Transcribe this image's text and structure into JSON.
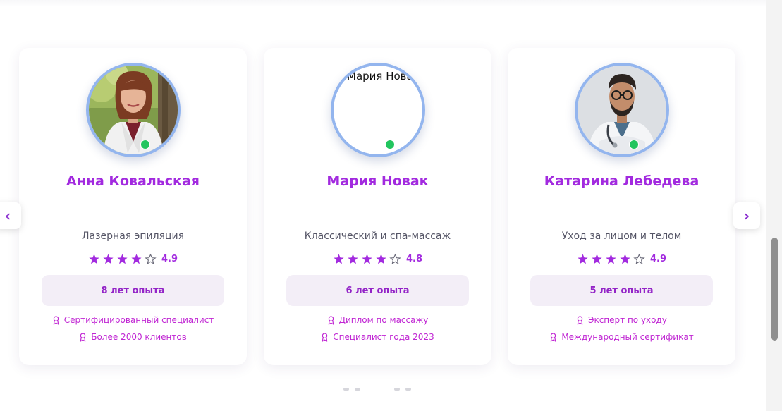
{
  "nav": {
    "prev_icon": "chevron-left-icon",
    "prev_glyph": "‹",
    "next_icon": "chevron-right-icon",
    "next_glyph": "›"
  },
  "colors": {
    "accent": "#a22adf",
    "online": "#22c55e",
    "experience_bg": "#f3eef7",
    "certificate_text": "#c026d3"
  },
  "specialists": [
    {
      "name": "Анна Ковальская",
      "specialty": "Лазерная эпиляция",
      "stars_filled": 4,
      "stars_total": 5,
      "rating": "4.9",
      "experience": "8 лет опыта",
      "certificates": [
        "Сертифицированный специалист",
        "Более 2000 клиентов"
      ],
      "photo_alt": "",
      "online": true
    },
    {
      "name": "Мария Новак",
      "specialty": "Классический и спа-массаж",
      "stars_filled": 4,
      "stars_total": 5,
      "rating": "4.8",
      "experience": "6 лет опыта",
      "certificates": [
        "Диплом по массажу",
        "Специалист года 2023"
      ],
      "photo_alt": "Мария Новак",
      "online": true
    },
    {
      "name": "Катарина Лебедева",
      "specialty": "Уход за лицом и телом",
      "stars_filled": 4,
      "stars_total": 5,
      "rating": "4.9",
      "experience": "5 лет опыта",
      "certificates": [
        "Эксперт по уходу",
        "Международный сертификат"
      ],
      "photo_alt": "",
      "online": true
    }
  ],
  "pagination": {
    "pages": 4,
    "current": 0
  }
}
